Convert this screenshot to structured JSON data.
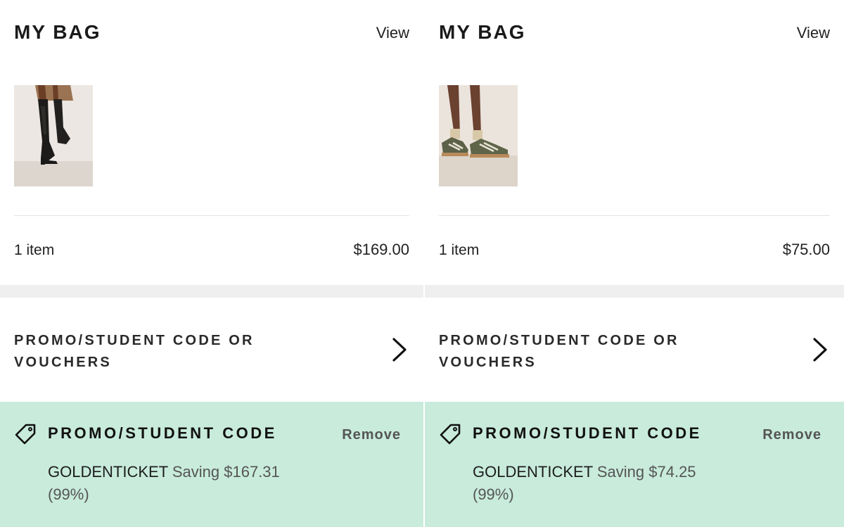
{
  "panels": [
    {
      "title": "MY BAG",
      "view_label": "View",
      "product_image": "knee-high-black-boot",
      "item_count": "1 item",
      "total": "$169.00",
      "promo_row_label": "PROMO/STUDENT CODE OR VOUCHERS",
      "applied": {
        "title": "PROMO/STUDENT CODE",
        "remove_label": "Remove",
        "code": "GOLDENTICKET",
        "saving_text": "Saving $167.31",
        "percent": "(99%)"
      }
    },
    {
      "title": "MY BAG",
      "view_label": "View",
      "product_image": "olive-green-sneaker",
      "item_count": "1 item",
      "total": "$75.00",
      "promo_row_label": "PROMO/STUDENT CODE OR VOUCHERS",
      "applied": {
        "title": "PROMO/STUDENT CODE",
        "remove_label": "Remove",
        "code": "GOLDENTICKET",
        "saving_text": "Saving $74.25",
        "percent": "(99%)"
      }
    }
  ],
  "colors": {
    "applied_background": "#c8ebdc",
    "separator_band": "#efefef"
  },
  "icons": [
    "tag-icon",
    "chevron-right-icon"
  ]
}
